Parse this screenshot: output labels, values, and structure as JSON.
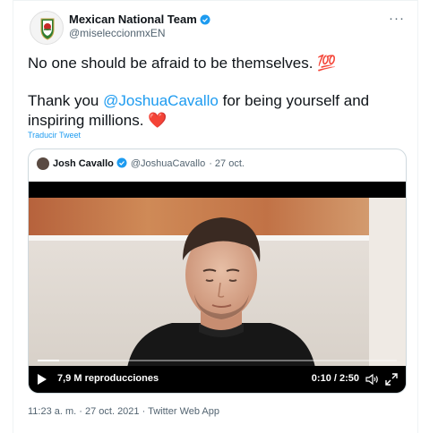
{
  "tweet": {
    "author_name": "Mexican National Team",
    "author_handle": "@miseleccionmxEN",
    "text_line1": "No one should be afraid to be themselves. ",
    "emoji_100": "💯",
    "text_thank_before": "Thank you ",
    "mention": "@JoshuaCavallo",
    "text_thank_after": " for being yourself and inspiring millions. ",
    "heart": "❤️",
    "translate_label": "Traducir Tweet",
    "timestamp": "11:23 a. m. · 27 oct. 2021 · Twitter Web App",
    "more_icon": "···"
  },
  "quoted": {
    "author_name": "Josh Cavallo",
    "author_handle": "@JoshuaCavallo",
    "date": "· 27 oct."
  },
  "video": {
    "views": "7,9 M reproducciones",
    "time": "0:10 / 2:50",
    "progress": 0.06
  },
  "colors": {
    "accent": "#1d9bf0",
    "text": "#0f1419",
    "secondary": "#536471"
  }
}
